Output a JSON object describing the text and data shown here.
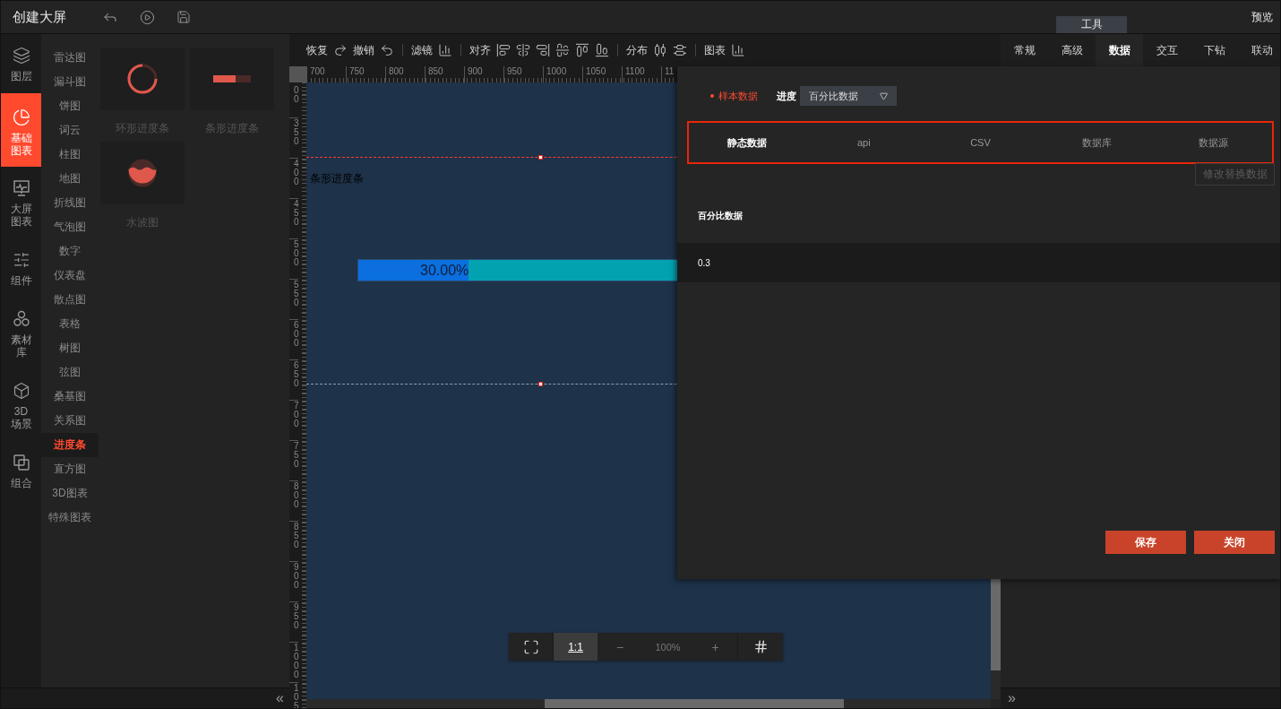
{
  "top_bar": {
    "title": "创建大屏",
    "tool_tab": "工具",
    "preview": "预览"
  },
  "rail": [
    {
      "label": "图层",
      "selected": false
    },
    {
      "label": "基础图表",
      "selected": true
    },
    {
      "label": "大屏图表",
      "selected": false
    },
    {
      "label": "组件",
      "selected": false
    },
    {
      "label": "素材库",
      "selected": false
    },
    {
      "label": "3D场景",
      "selected": false
    },
    {
      "label": "组合",
      "selected": false
    }
  ],
  "categories": [
    {
      "label": "雷达图",
      "selected": false
    },
    {
      "label": "漏斗图",
      "selected": false
    },
    {
      "label": "饼图",
      "selected": false
    },
    {
      "label": "词云",
      "selected": false
    },
    {
      "label": "柱图",
      "selected": false
    },
    {
      "label": "地图",
      "selected": false
    },
    {
      "label": "折线图",
      "selected": false
    },
    {
      "label": "气泡图",
      "selected": false
    },
    {
      "label": "数字",
      "selected": false
    },
    {
      "label": "仪表盘",
      "selected": false
    },
    {
      "label": "散点图",
      "selected": false
    },
    {
      "label": "表格",
      "selected": false
    },
    {
      "label": "树图",
      "selected": false
    },
    {
      "label": "弦图",
      "selected": false
    },
    {
      "label": "桑基图",
      "selected": false
    },
    {
      "label": "关系图",
      "selected": false
    },
    {
      "label": "进度条",
      "selected": true
    },
    {
      "label": "直方图",
      "selected": false
    },
    {
      "label": "3D图表",
      "selected": false
    },
    {
      "label": "特殊图表",
      "selected": false
    }
  ],
  "thumbnails": [
    {
      "kind": "ring",
      "label": "环形进度条"
    },
    {
      "kind": "bar",
      "label": "条形进度条"
    },
    {
      "kind": "wave",
      "label": "水波图"
    }
  ],
  "left_collapse": "«",
  "toolbar": {
    "redo": "恢复",
    "undo": "撤销",
    "filter": "滤镜",
    "align": "对齐",
    "distribute": "分布",
    "chart": "图表"
  },
  "ruler": {
    "x_labels": [
      "700",
      "750",
      "800",
      "850",
      "900",
      "950",
      "1000",
      "1050",
      "1100",
      "11"
    ],
    "y_labels": [
      "00",
      "350",
      "400",
      "450",
      "500",
      "550",
      "600",
      "650",
      "700",
      "750",
      "800",
      "850",
      "900",
      "950",
      "1000",
      "105"
    ]
  },
  "canvas": {
    "element_label": "条形进度条",
    "progress": {
      "text": "30.00%",
      "level": 0.3
    }
  },
  "zoom_bar": {
    "ratio": "1:1",
    "minus": "−",
    "zoom": "100%",
    "plus": "+"
  },
  "right_tabs": [
    {
      "label": "常规",
      "selected": false
    },
    {
      "label": "高级",
      "selected": false
    },
    {
      "label": "数据",
      "selected": true
    },
    {
      "label": "交互",
      "selected": false
    },
    {
      "label": "下钻",
      "selected": false
    },
    {
      "label": "联动",
      "selected": false
    }
  ],
  "right_expand": "»",
  "data_panel": {
    "sample_label": "样本数据",
    "progress_label": "进度",
    "progress_select": "百分比数据",
    "source_tabs": [
      {
        "label": "静态数据",
        "selected": true
      },
      {
        "label": "api",
        "selected": false
      },
      {
        "label": "CSV",
        "selected": false
      },
      {
        "label": "数据库",
        "selected": false
      },
      {
        "label": "数据源",
        "selected": false
      }
    ],
    "replace_button": "修改替换数据",
    "table": {
      "header": "百分比数据",
      "value": "0.3"
    },
    "buttons": [
      "保存",
      "关闭"
    ]
  }
}
